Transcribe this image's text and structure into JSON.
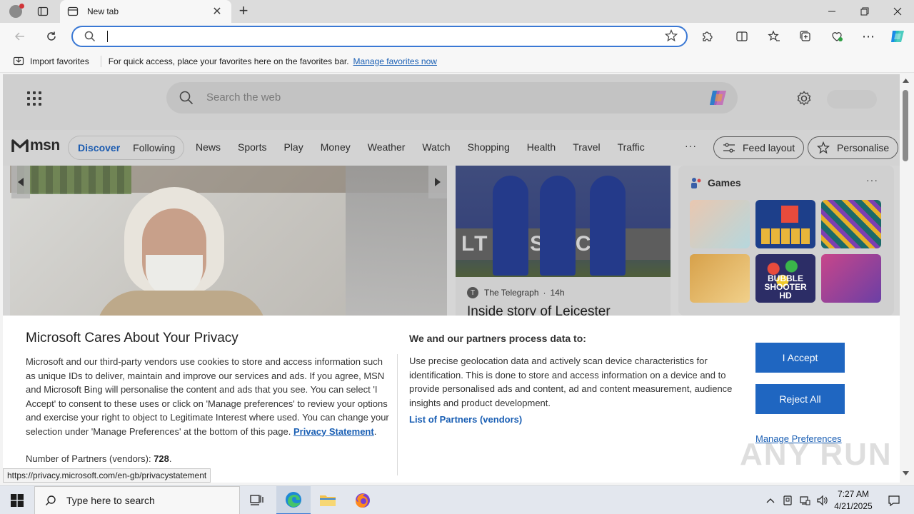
{
  "browser": {
    "tab_title": "New tab",
    "new_tab_glyph": "+",
    "close_tab_glyph": "✕",
    "window_controls": {
      "minimize": "—",
      "restore": "❐",
      "close": "✕"
    },
    "address_value": "",
    "toolbar_more": "⋯"
  },
  "favorites_bar": {
    "import_label": "Import favorites",
    "message": "For quick access, place your favorites here on the favorites bar.",
    "link": "Manage favorites now"
  },
  "newtab": {
    "search_placeholder": "Search the web",
    "brand": "msn",
    "pills": [
      "Discover",
      "Following"
    ],
    "nav_links": [
      "News",
      "Sports",
      "Play",
      "Money",
      "Weather",
      "Watch",
      "Shopping",
      "Health",
      "Travel",
      "Traffic"
    ],
    "more": "···",
    "feed_layout": "Feed layout",
    "personalise": "Personalise",
    "story": {
      "source": "The Telegraph",
      "age": "14h",
      "separator": "·",
      "headline": "Inside story of Leicester",
      "banner_text": "LT   POSTAC"
    },
    "games": {
      "title": "Games",
      "more": "···",
      "tiles": [
        {
          "name": "game-tile-1",
          "colors": [
            "#e9c7b0",
            "#b6d7dd"
          ]
        },
        {
          "name": "game-tile-2",
          "colors": [
            "#1d3f8a",
            "#e84b3c"
          ]
        },
        {
          "name": "game-tile-3",
          "colors": [
            "#1b6a6a",
            "#e6b02a"
          ]
        },
        {
          "name": "game-tile-4",
          "colors": [
            "#d7a14a",
            "#f1d08a"
          ]
        },
        {
          "name": "game-tile-5",
          "colors": [
            "#2c2d66",
            "#e84b3c"
          ],
          "text": "BUBBLE SHOOTER HD"
        },
        {
          "name": "game-tile-6",
          "colors": [
            "#c8468a",
            "#6b3fa5"
          ]
        }
      ]
    }
  },
  "privacy": {
    "title": "Microsoft Cares About Your Privacy",
    "body": "Microsoft and our third-party vendors use cookies to store and access information such as unique IDs to deliver, maintain and improve our services and ads. If you agree, MSN and Microsoft Bing will personalise the content and ads that you see. You can select 'I Accept' to consent to these uses or click on 'Manage preferences' to review your options and exercise your right to object to Legitimate Interest where used.  You can change your selection under 'Manage Preferences' at the bottom of this page. ",
    "statement_link": "Privacy Statement",
    "statement_after": ".",
    "partners_count_label": "Number of Partners (vendors):",
    "partners_count": "728",
    "partners_count_after": ".",
    "subheading": "We and our partners process data to:",
    "purposes": "Use precise geolocation data and actively scan device characteristics for identification. This is done to store and access information on a device and to provide personalised ads and content, ad and content measurement, audience insights and product development.",
    "partners_link": "List of Partners (vendors)",
    "accept": "I Accept",
    "reject": "Reject All",
    "manage": "Manage Preferences"
  },
  "status_url": "https://privacy.microsoft.com/en-gb/privacystatement",
  "watermark": "ANY RUN",
  "taskbar": {
    "search_placeholder": "Type here to search",
    "time": "7:27 AM",
    "date": "4/21/2025"
  },
  "colors": {
    "accent": "#1f66c1",
    "link": "#1a5fb4",
    "omnibox_focus": "#3a78d4"
  }
}
